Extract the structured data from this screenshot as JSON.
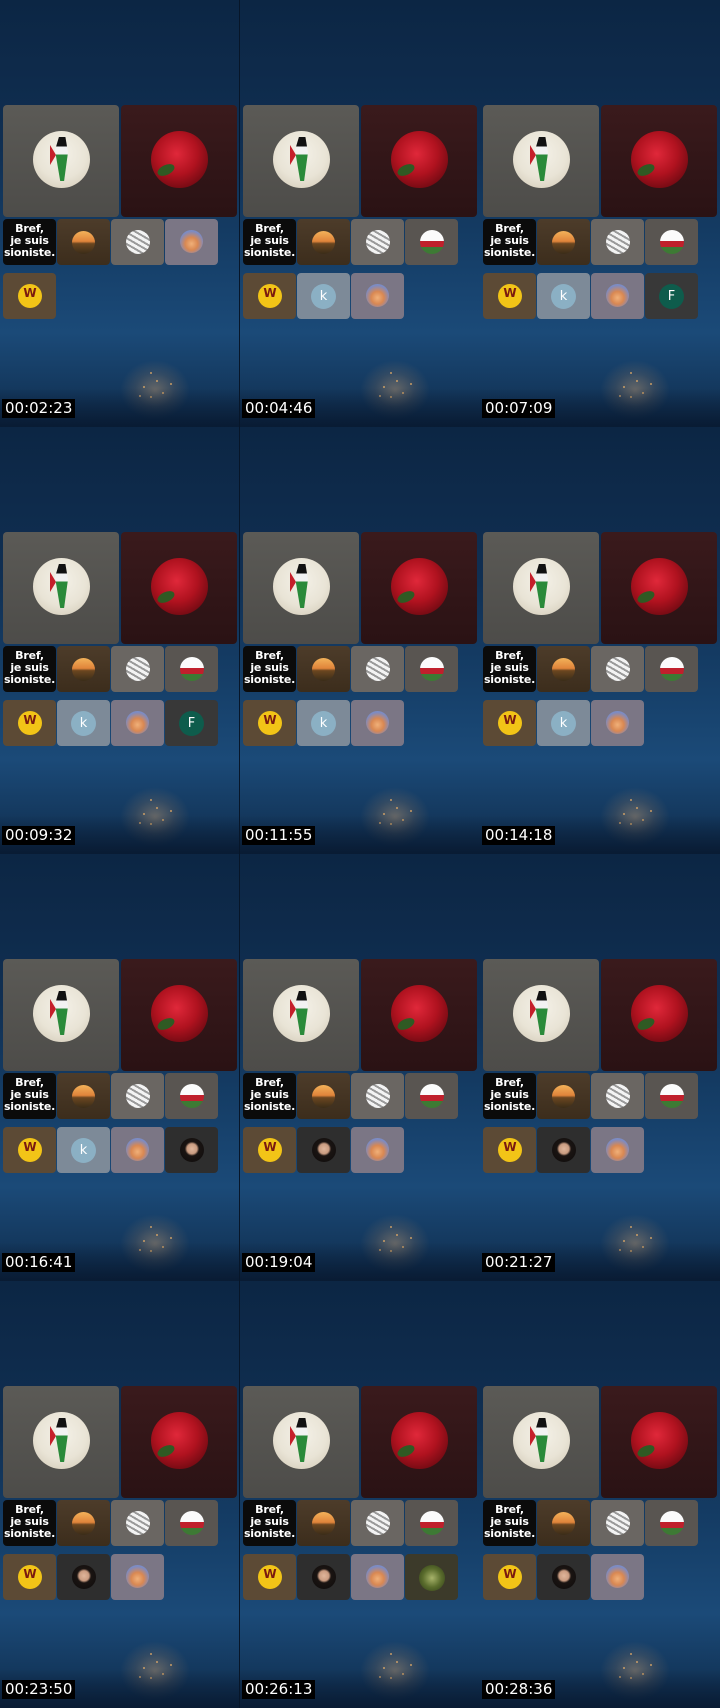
{
  "sheet": {
    "columns": 3,
    "rows": 4,
    "frames": [
      {
        "timestamp": "00:02:23",
        "row1": [
          "bref",
          "sunset",
          "ball",
          "light"
        ],
        "row2": [
          "w"
        ]
      },
      {
        "timestamp": "00:04:46",
        "row1": [
          "bref",
          "sunset",
          "ball",
          "flag"
        ],
        "row2": [
          "w",
          "k",
          "light"
        ]
      },
      {
        "timestamp": "00:07:09",
        "row1": [
          "bref",
          "sunset",
          "ball",
          "flag"
        ],
        "row2": [
          "w",
          "k",
          "light",
          "F"
        ]
      },
      {
        "timestamp": "00:09:32",
        "row1": [
          "bref",
          "sunset",
          "ball",
          "flag"
        ],
        "row2": [
          "w",
          "k",
          "light",
          "F"
        ]
      },
      {
        "timestamp": "00:11:55",
        "row1": [
          "bref",
          "sunset",
          "ball",
          "flag"
        ],
        "row2": [
          "w",
          "k",
          "light"
        ]
      },
      {
        "timestamp": "00:14:18",
        "row1": [
          "bref",
          "sunset",
          "ball",
          "flag"
        ],
        "row2": [
          "w",
          "k",
          "light"
        ]
      },
      {
        "timestamp": "00:16:41",
        "row1": [
          "bref",
          "sunset",
          "ball",
          "flag"
        ],
        "row2": [
          "w",
          "k",
          "light",
          "woman"
        ]
      },
      {
        "timestamp": "00:19:04",
        "row1": [
          "bref",
          "sunset",
          "ball",
          "flag"
        ],
        "row2": [
          "w",
          "woman",
          "light"
        ]
      },
      {
        "timestamp": "00:21:27",
        "row1": [
          "bref",
          "sunset",
          "ball",
          "flag"
        ],
        "row2": [
          "w",
          "woman",
          "light"
        ]
      },
      {
        "timestamp": "00:23:50",
        "row1": [
          "bref",
          "sunset",
          "ball",
          "flag"
        ],
        "row2": [
          "w",
          "woman",
          "light"
        ]
      },
      {
        "timestamp": "00:26:13",
        "row1": [
          "bref",
          "sunset",
          "ball",
          "flag"
        ],
        "row2": [
          "w",
          "woman",
          "light",
          "green"
        ]
      },
      {
        "timestamp": "00:28:36",
        "row1": [
          "bref",
          "sunset",
          "ball",
          "flag"
        ],
        "row2": [
          "w",
          "woman",
          "light"
        ]
      }
    ]
  },
  "labels": {
    "bref_line1": "Bref,",
    "bref_line2": "je suis",
    "bref_line3": "sioniste.",
    "k_initial": "k",
    "f_initial": "F",
    "w_logo": "W"
  },
  "icons": {
    "bref": "bref-text-avatar",
    "sunset": "sunset-avatar",
    "ball": "ball-avatar",
    "light": "light-avatar",
    "flag": "flag-avatar",
    "w": "w-logo-avatar",
    "k": "k-initial-avatar",
    "F": "f-initial-avatar",
    "woman": "woman-portrait-avatar",
    "green": "green-landscape-avatar"
  },
  "colors": {
    "background": "#0e2b4a",
    "timestamp_bg": "#000000",
    "timestamp_fg": "#ffffff"
  }
}
